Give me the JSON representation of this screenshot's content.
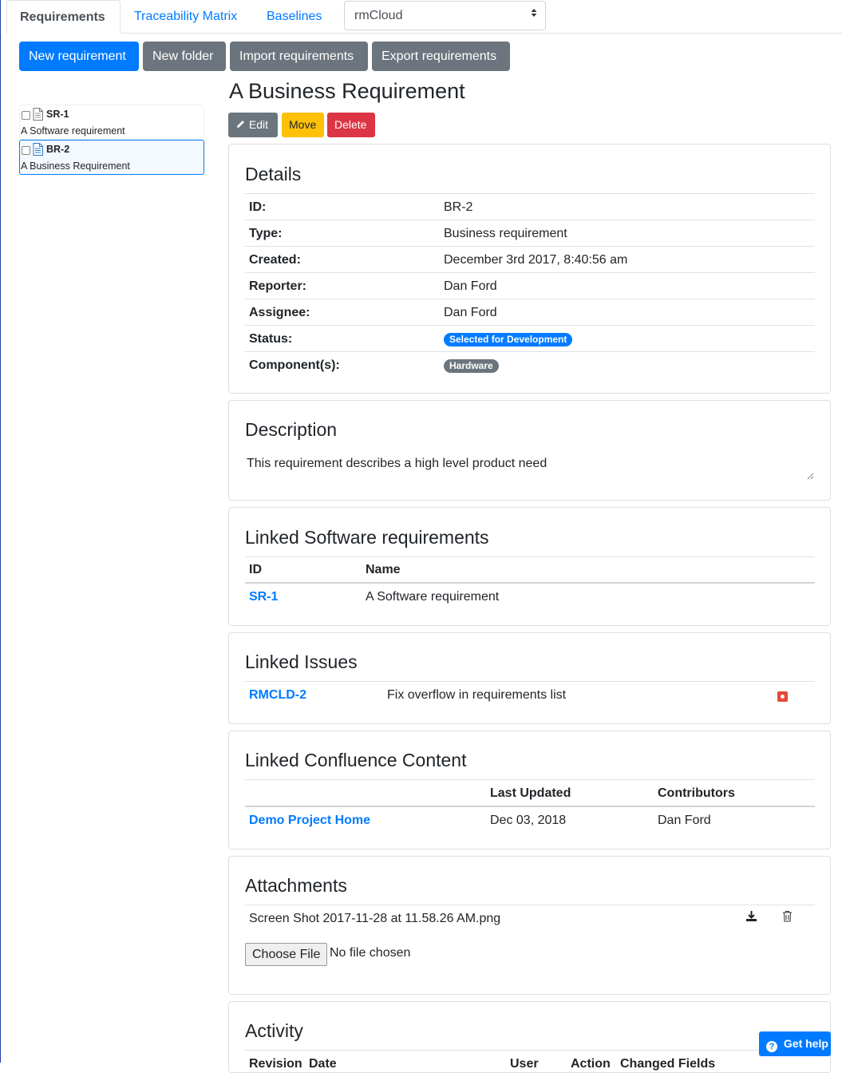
{
  "tabs": [
    {
      "label": "Requirements",
      "active": true
    },
    {
      "label": "Traceability Matrix",
      "active": false
    },
    {
      "label": "Baselines",
      "active": false
    }
  ],
  "project_select": {
    "value": "rmCloud"
  },
  "toolbar": {
    "new_requirement": "New requirement",
    "new_folder": "New folder",
    "import_requirements": "Import requirements",
    "export_requirements": "Export requirements"
  },
  "tree": [
    {
      "id": "SR-1",
      "name": "A Software requirement",
      "selected": false
    },
    {
      "id": "BR-2",
      "name": "A Business Requirement",
      "selected": true
    }
  ],
  "requirement": {
    "title": "A Business Requirement",
    "actions": {
      "edit": "Edit",
      "move": "Move",
      "delete": "Delete"
    }
  },
  "details": {
    "heading": "Details",
    "rows": [
      {
        "label": "ID:",
        "value": "BR-2"
      },
      {
        "label": "Type:",
        "value": "Business requirement"
      },
      {
        "label": "Created:",
        "value": "December 3rd 2017, 8:40:56 am"
      },
      {
        "label": "Reporter:",
        "value": "Dan Ford"
      },
      {
        "label": "Assignee:",
        "value": "Dan Ford"
      },
      {
        "label": "Status:",
        "value": "Selected for Development"
      },
      {
        "label": "Component(s):",
        "value": "Hardware"
      }
    ]
  },
  "description": {
    "heading": "Description",
    "text": "This requirement describes a high level product need"
  },
  "linked_software": {
    "heading": "Linked Software requirements",
    "columns": [
      "ID",
      "Name"
    ],
    "rows": [
      {
        "id": "SR-1",
        "name": "A Software requirement"
      }
    ]
  },
  "linked_issues": {
    "heading": "Linked Issues",
    "rows": [
      {
        "key": "RMCLD-2",
        "summary": "Fix overflow in requirements list"
      }
    ]
  },
  "linked_confluence": {
    "heading": "Linked Confluence Content",
    "columns": [
      "",
      "Last Updated",
      "Contributors"
    ],
    "rows": [
      {
        "title": "Demo Project Home",
        "updated": "Dec 03, 2018",
        "contributors": "Dan Ford"
      }
    ]
  },
  "attachments": {
    "heading": "Attachments",
    "files": [
      {
        "name": "Screen Shot 2017-11-28 at 11.58.26 AM.png"
      }
    ],
    "choose_file": "Choose File",
    "no_file": "No file chosen"
  },
  "activity": {
    "heading": "Activity",
    "columns": [
      "Revision",
      "Date",
      "User",
      "Action",
      "Changed Fields"
    ]
  },
  "help": {
    "label": "Get help"
  },
  "colors": {
    "primary": "#007bff",
    "secondary": "#6c757d",
    "warning": "#ffc107",
    "danger": "#dc3545"
  },
  "icons": [
    "pencil-icon",
    "document-icon",
    "sort-caret-icon",
    "jira-issue-icon",
    "download-icon",
    "trash-icon",
    "question-circle-icon",
    "resize-grip-icon"
  ]
}
